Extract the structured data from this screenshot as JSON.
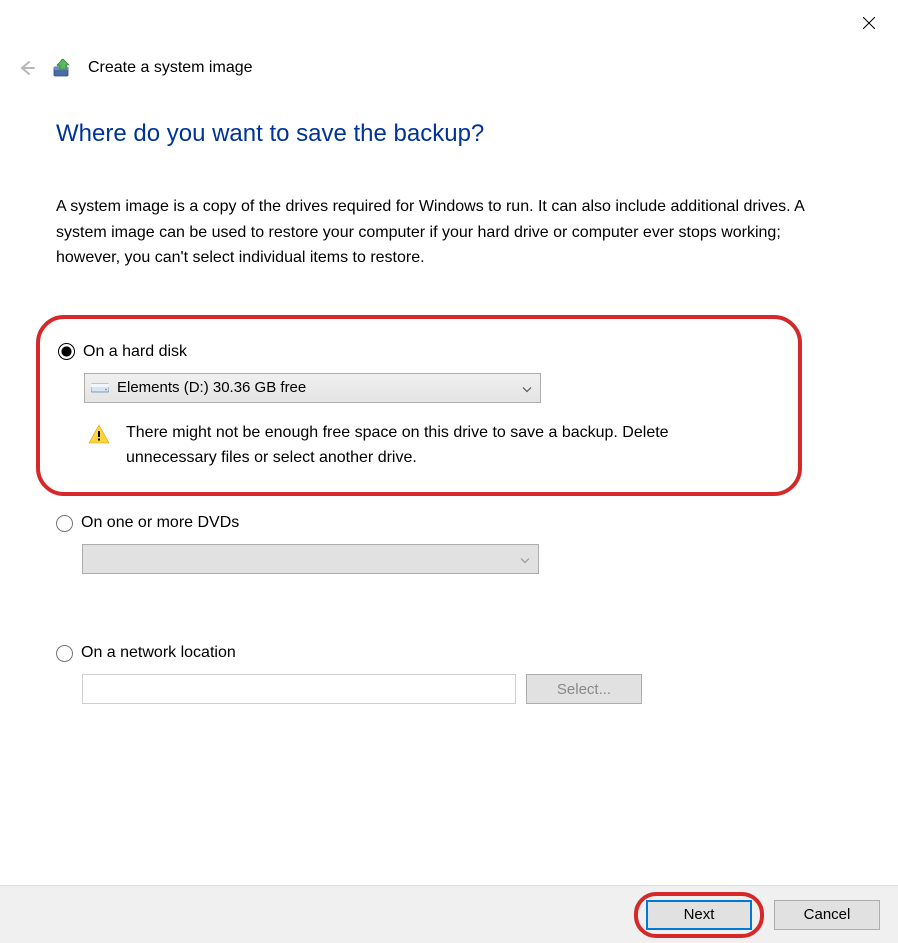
{
  "header": {
    "title": "Create a system image"
  },
  "page": {
    "heading": "Where do you want to save the backup?",
    "description": "A system image is a copy of the drives required for Windows to run. It can also include additional drives. A system image can be used to restore your computer if your hard drive or computer ever stops working; however, you can't select individual items to restore."
  },
  "options": {
    "hardDisk": {
      "label": "On a hard disk",
      "selectedDrive": "Elements (D:)  30.36 GB free",
      "warning": "There might not be enough free space on this drive to save a backup. Delete unnecessary files or select another drive."
    },
    "dvd": {
      "label": "On one or more DVDs",
      "selectedValue": ""
    },
    "network": {
      "label": "On a network location",
      "value": "",
      "selectButton": "Select..."
    }
  },
  "footer": {
    "next": "Next",
    "cancel": "Cancel"
  }
}
